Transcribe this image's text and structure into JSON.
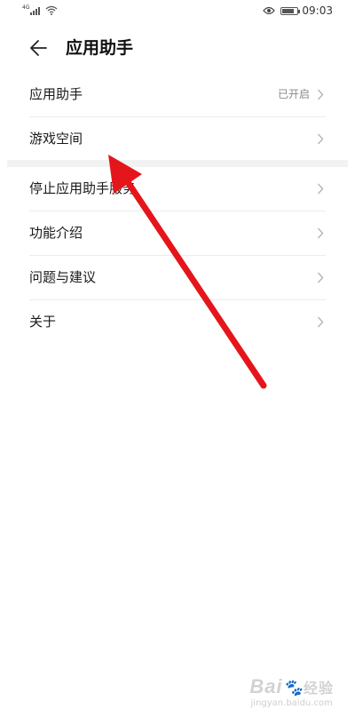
{
  "status_bar": {
    "network": "4G",
    "time": "09:03",
    "battery_level": 0.8
  },
  "header": {
    "title": "应用助手"
  },
  "list_top": [
    {
      "label": "应用助手",
      "status": "已开启"
    },
    {
      "label": "游戏空间",
      "status": ""
    }
  ],
  "list_bottom": [
    {
      "label": "停止应用助手服务"
    },
    {
      "label": "功能介绍"
    },
    {
      "label": "问题与建议"
    },
    {
      "label": "关于"
    }
  ],
  "watermark": {
    "logo": "Bai",
    "logo_suffix": "经验",
    "url": "jingyan.baidu.com"
  },
  "colors": {
    "annotation_arrow": "#e4161c",
    "divider": "#f2f2f2",
    "secondary_text": "#8a8a8a"
  }
}
